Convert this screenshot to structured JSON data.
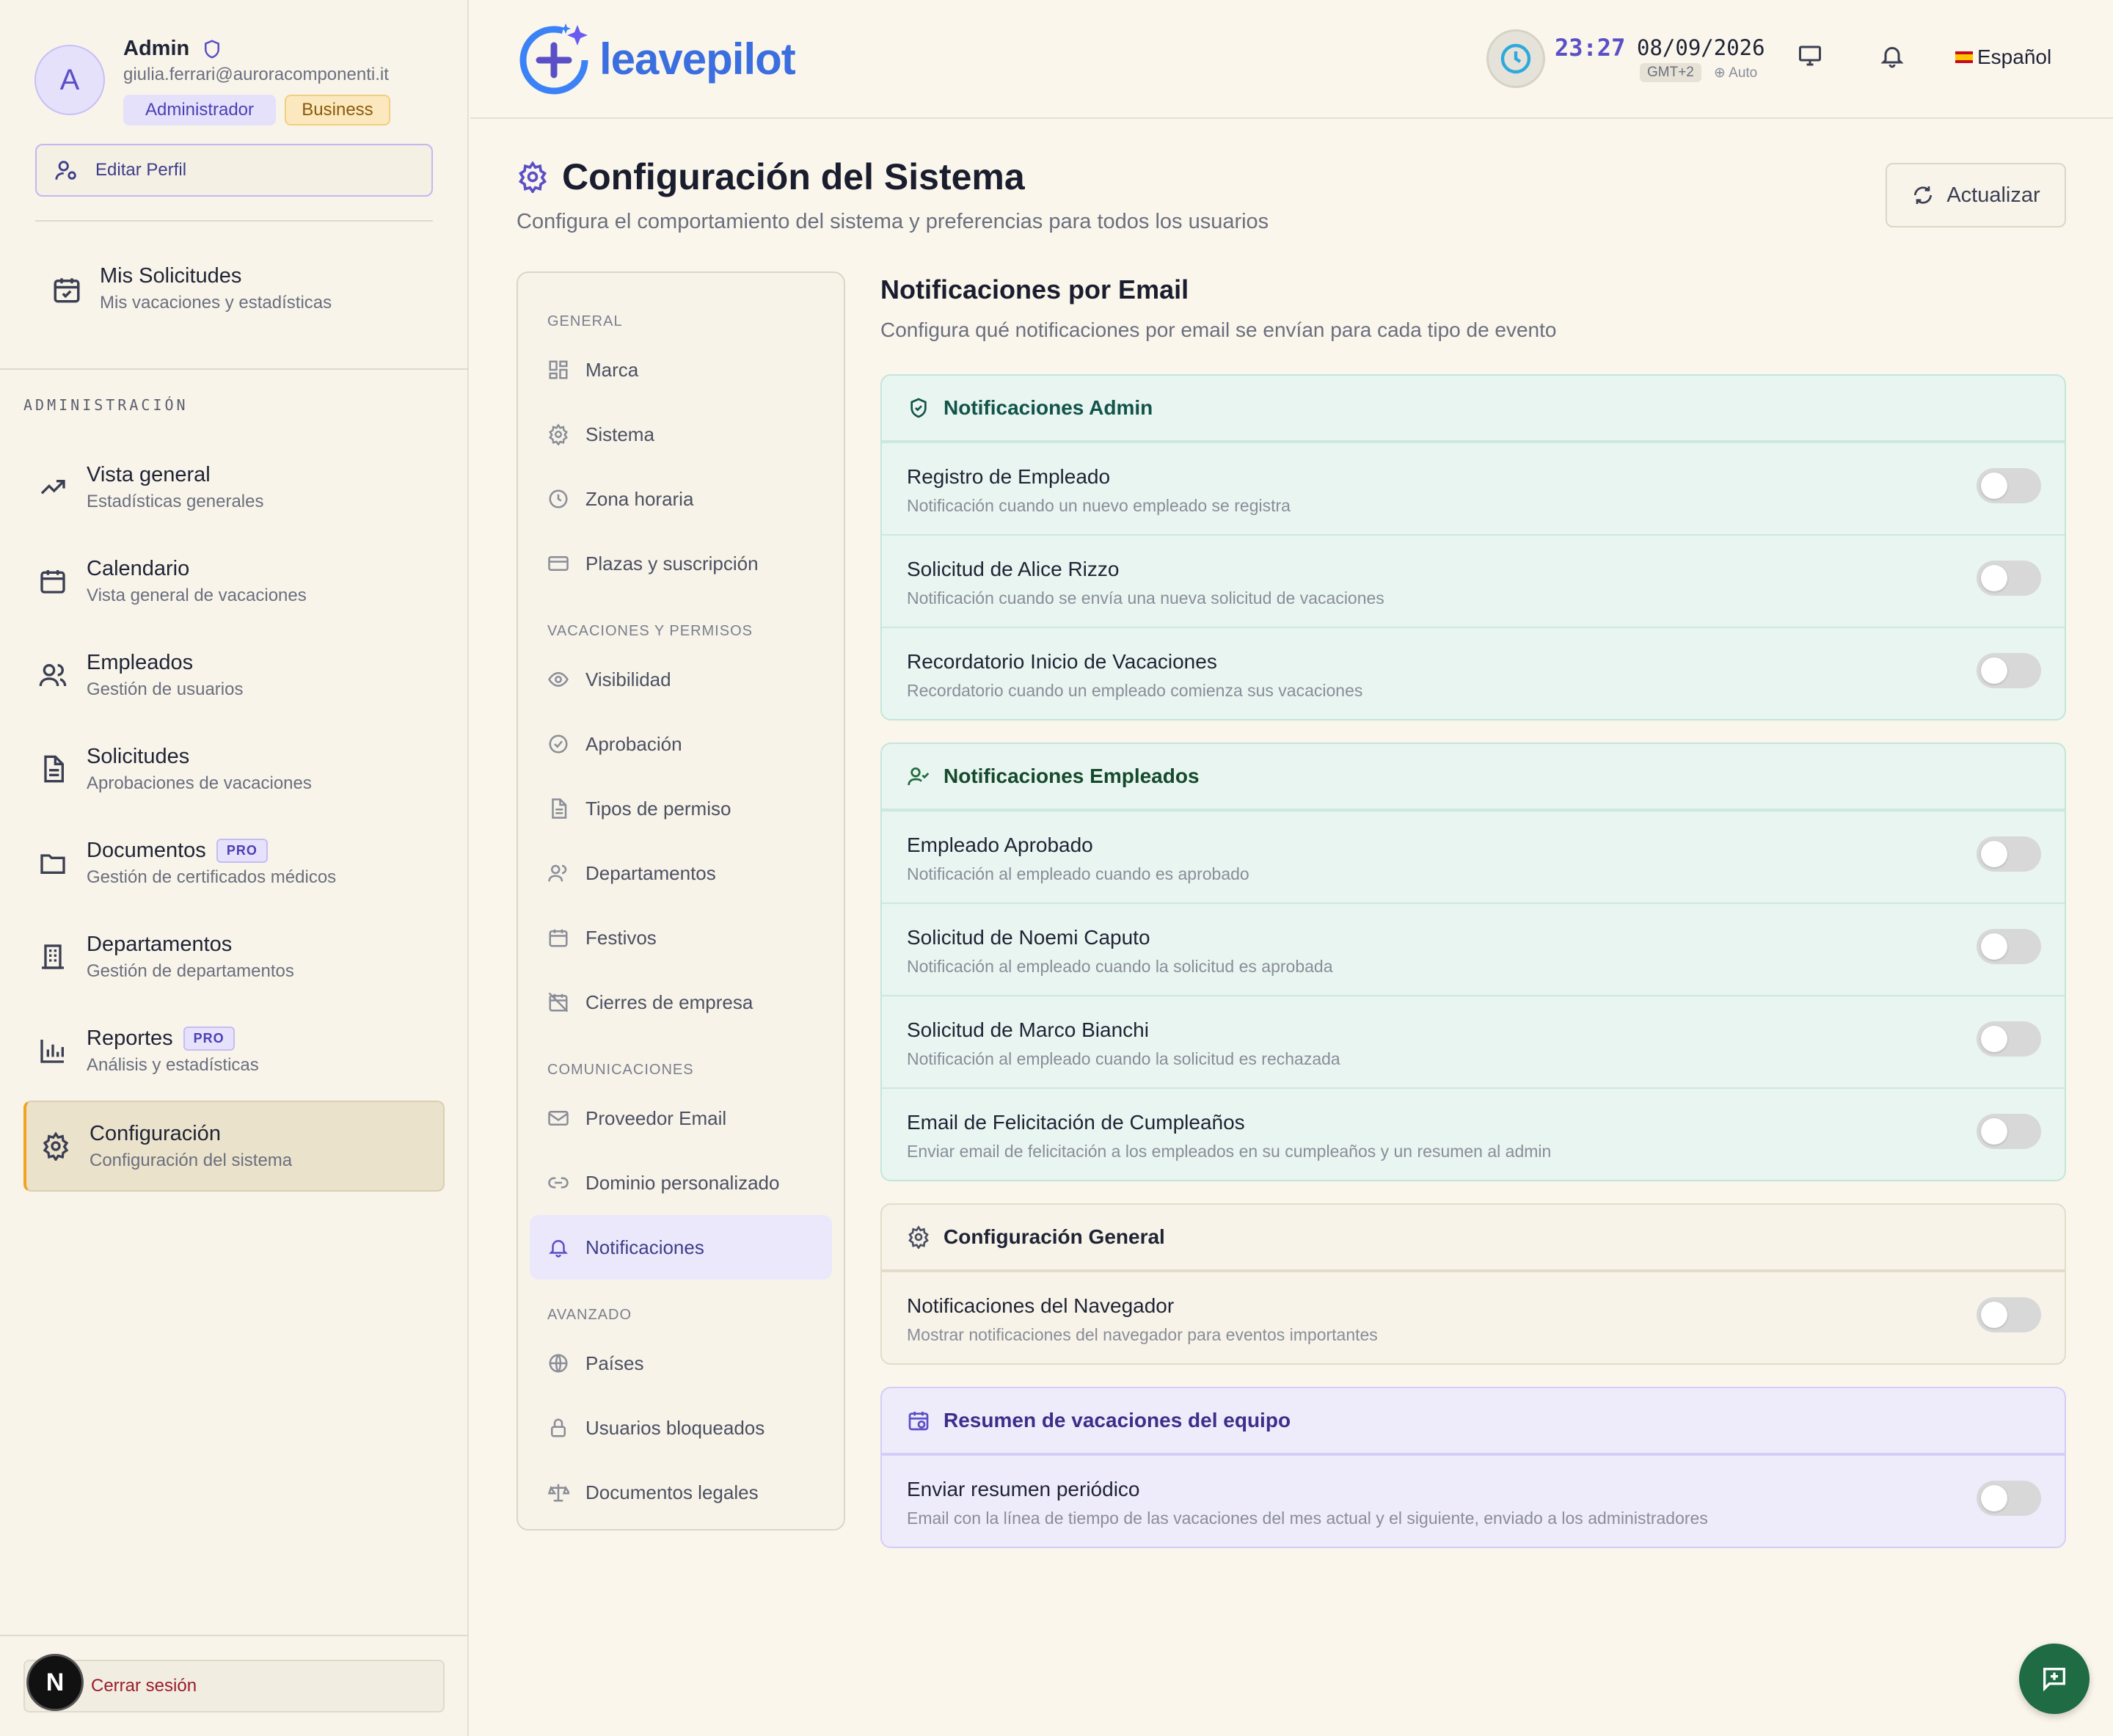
{
  "profile": {
    "initial": "A",
    "name": "Admin",
    "email": "giulia.ferrari@auroracomponenti.it",
    "role_badge": "Administrador",
    "plan_badge": "Business",
    "edit_label": "Editar Perfil"
  },
  "my_requests": {
    "title": "Mis Solicitudes",
    "subtitle": "Mis vacaciones y estadísticas"
  },
  "admin_section": "ADMINISTRACIÓN",
  "nav": [
    {
      "title": "Vista general",
      "subtitle": "Estadísticas generales",
      "icon": "trending-up-icon"
    },
    {
      "title": "Calendario",
      "subtitle": "Vista general de vacaciones",
      "icon": "calendar-icon"
    },
    {
      "title": "Empleados",
      "subtitle": "Gestión de usuarios",
      "icon": "users-icon"
    },
    {
      "title": "Solicitudes",
      "subtitle": "Aprobaciones de vacaciones",
      "icon": "document-icon"
    },
    {
      "title": "Documentos",
      "subtitle": "Gestión de certificados médicos",
      "icon": "folder-icon",
      "badge": "PRO"
    },
    {
      "title": "Departamentos",
      "subtitle": "Gestión de departamentos",
      "icon": "building-icon"
    },
    {
      "title": "Reportes",
      "subtitle": "Análisis y estadísticas",
      "icon": "bar-chart-icon",
      "badge": "PRO"
    },
    {
      "title": "Configuración",
      "subtitle": "Configuración del sistema",
      "icon": "gear-icon",
      "active": true
    }
  ],
  "logout_label": "Cerrar sesión",
  "logout_avatar": "N",
  "topbar": {
    "logo_text": "leavepilot",
    "time": "23:27",
    "date": "08/09/2026",
    "timezone": "GMT+2",
    "tz_mode": "Auto",
    "language": "Español"
  },
  "page": {
    "title": "Configuración del Sistema",
    "subtitle": "Configura el comportamiento del sistema y preferencias para todos los usuarios",
    "refresh_label": "Actualizar"
  },
  "settings_nav": [
    {
      "group": "GENERAL",
      "items": [
        {
          "label": "Marca",
          "icon": "layout-icon"
        },
        {
          "label": "Sistema",
          "icon": "gear-icon"
        },
        {
          "label": "Zona horaria",
          "icon": "clock-icon"
        },
        {
          "label": "Plazas y suscripción",
          "icon": "credit-card-icon"
        }
      ]
    },
    {
      "group": "VACACIONES Y PERMISOS",
      "items": [
        {
          "label": "Visibilidad",
          "icon": "eye-icon"
        },
        {
          "label": "Aprobación",
          "icon": "check-circle-icon"
        },
        {
          "label": "Tipos de permiso",
          "icon": "document-icon"
        },
        {
          "label": "Departamentos",
          "icon": "users-icon"
        },
        {
          "label": "Festivos",
          "icon": "calendar-icon"
        },
        {
          "label": "Cierres de empresa",
          "icon": "calendar-off-icon"
        }
      ]
    },
    {
      "group": "COMUNICACIONES",
      "items": [
        {
          "label": "Proveedor Email",
          "icon": "mail-icon"
        },
        {
          "label": "Dominio personalizado",
          "icon": "link-icon"
        },
        {
          "label": "Notificaciones",
          "icon": "bell-icon",
          "active": true
        }
      ]
    },
    {
      "group": "AVANZADO",
      "items": [
        {
          "label": "Países",
          "icon": "globe-icon"
        },
        {
          "label": "Usuarios bloqueados",
          "icon": "lock-icon"
        },
        {
          "label": "Documentos legales",
          "icon": "scale-icon"
        }
      ]
    }
  ],
  "main": {
    "title": "Notificaciones por Email",
    "subtitle": "Configura qué notificaciones por email se envían para cada tipo de evento"
  },
  "cards": [
    {
      "title": "Notificaciones Admin",
      "rows": [
        {
          "title": "Registro de Empleado",
          "desc": "Notificación cuando un nuevo empleado se registra",
          "enabled": false
        },
        {
          "title": "Solicitud de Alice Rizzo",
          "desc": "Notificación cuando se envía una nueva solicitud de vacaciones",
          "enabled": false
        },
        {
          "title": "Recordatorio Inicio de Vacaciones",
          "desc": "Recordatorio cuando un empleado comienza sus vacaciones",
          "enabled": false
        }
      ]
    },
    {
      "title": "Notificaciones Empleados",
      "rows": [
        {
          "title": "Empleado Aprobado",
          "desc": "Notificación al empleado cuando es aprobado",
          "enabled": false
        },
        {
          "title": "Solicitud de Noemi Caputo",
          "desc": "Notificación al empleado cuando la solicitud es aprobada",
          "enabled": false
        },
        {
          "title": "Solicitud de Marco Bianchi",
          "desc": "Notificación al empleado cuando la solicitud es rechazada",
          "enabled": false
        },
        {
          "title": "Email de Felicitación de Cumpleaños",
          "desc": "Enviar email de felicitación a los empleados en su cumpleaños y un resumen al admin",
          "enabled": false
        }
      ]
    },
    {
      "title": "Configuración General",
      "rows": [
        {
          "title": "Notificaciones del Navegador",
          "desc": "Mostrar notificaciones del navegador para eventos importantes",
          "enabled": false
        }
      ]
    },
    {
      "title": "Resumen de vacaciones del equipo",
      "rows": [
        {
          "title": "Enviar resumen periódico",
          "desc": "Email con la línea de tiempo de las vacaciones del mes actual y el siguiente, enviado a los administradores",
          "enabled": false
        }
      ]
    }
  ]
}
